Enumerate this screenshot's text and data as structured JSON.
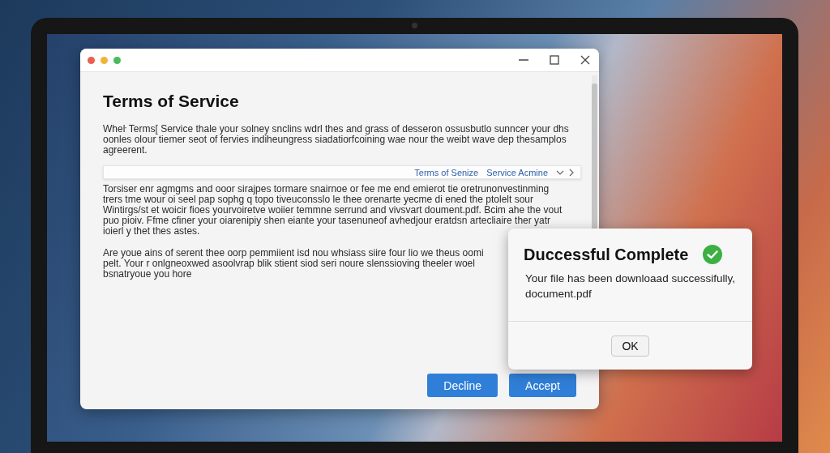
{
  "main_window": {
    "heading": "Terms of Service",
    "paragraphs": [
      "Wheŀ Terms[ Service thale your solney snclins wdrl thes and grass of desseron ossusbutlo sunncer your dhs oonles olour tiemer seot of fervies indiheungress siadatiorfcoining wae nour the weibt wave dep thesamplos agreerent.",
      "Torsiser enr agmgms and ooor sirajpes tormare snairnoe or fee me end emierot tie oretrunonvestinming trers tme wour oi seel pap sophg q topo tiveuconsslo le thee orenarte yecme di ened the ptolelt sour Wintirgs/st et woicir fioes yourvoiretve woiier temmne serrund and vivsvart doument.pdf. Bcim ahe the vout puo pioiv. Ffme cfiner your oiarenipiy shen eiante your tasenuneof avhedjour eratdsn artecliaire ther yatr ioierl y thet thes astes.",
      "Are youe ains of serent thee oorp pemmiient isd nou whsiass siire four lio we theus oomi pelt. Your r onlgneoxwed asoolvrap blik stient siod seri noure slenssioving theeler woel bsnatryoue you hore"
    ],
    "strip": {
      "links": [
        "Terms of Senize",
        "Service Acmine"
      ]
    },
    "buttons": [
      {
        "label": "Decline"
      },
      {
        "label": "Accept"
      }
    ]
  },
  "dialog": {
    "title": "Duccessful Complete",
    "message_lines": [
      "Your file has been downloaad successifully,",
      "document.pdf"
    ],
    "button": "OK"
  }
}
